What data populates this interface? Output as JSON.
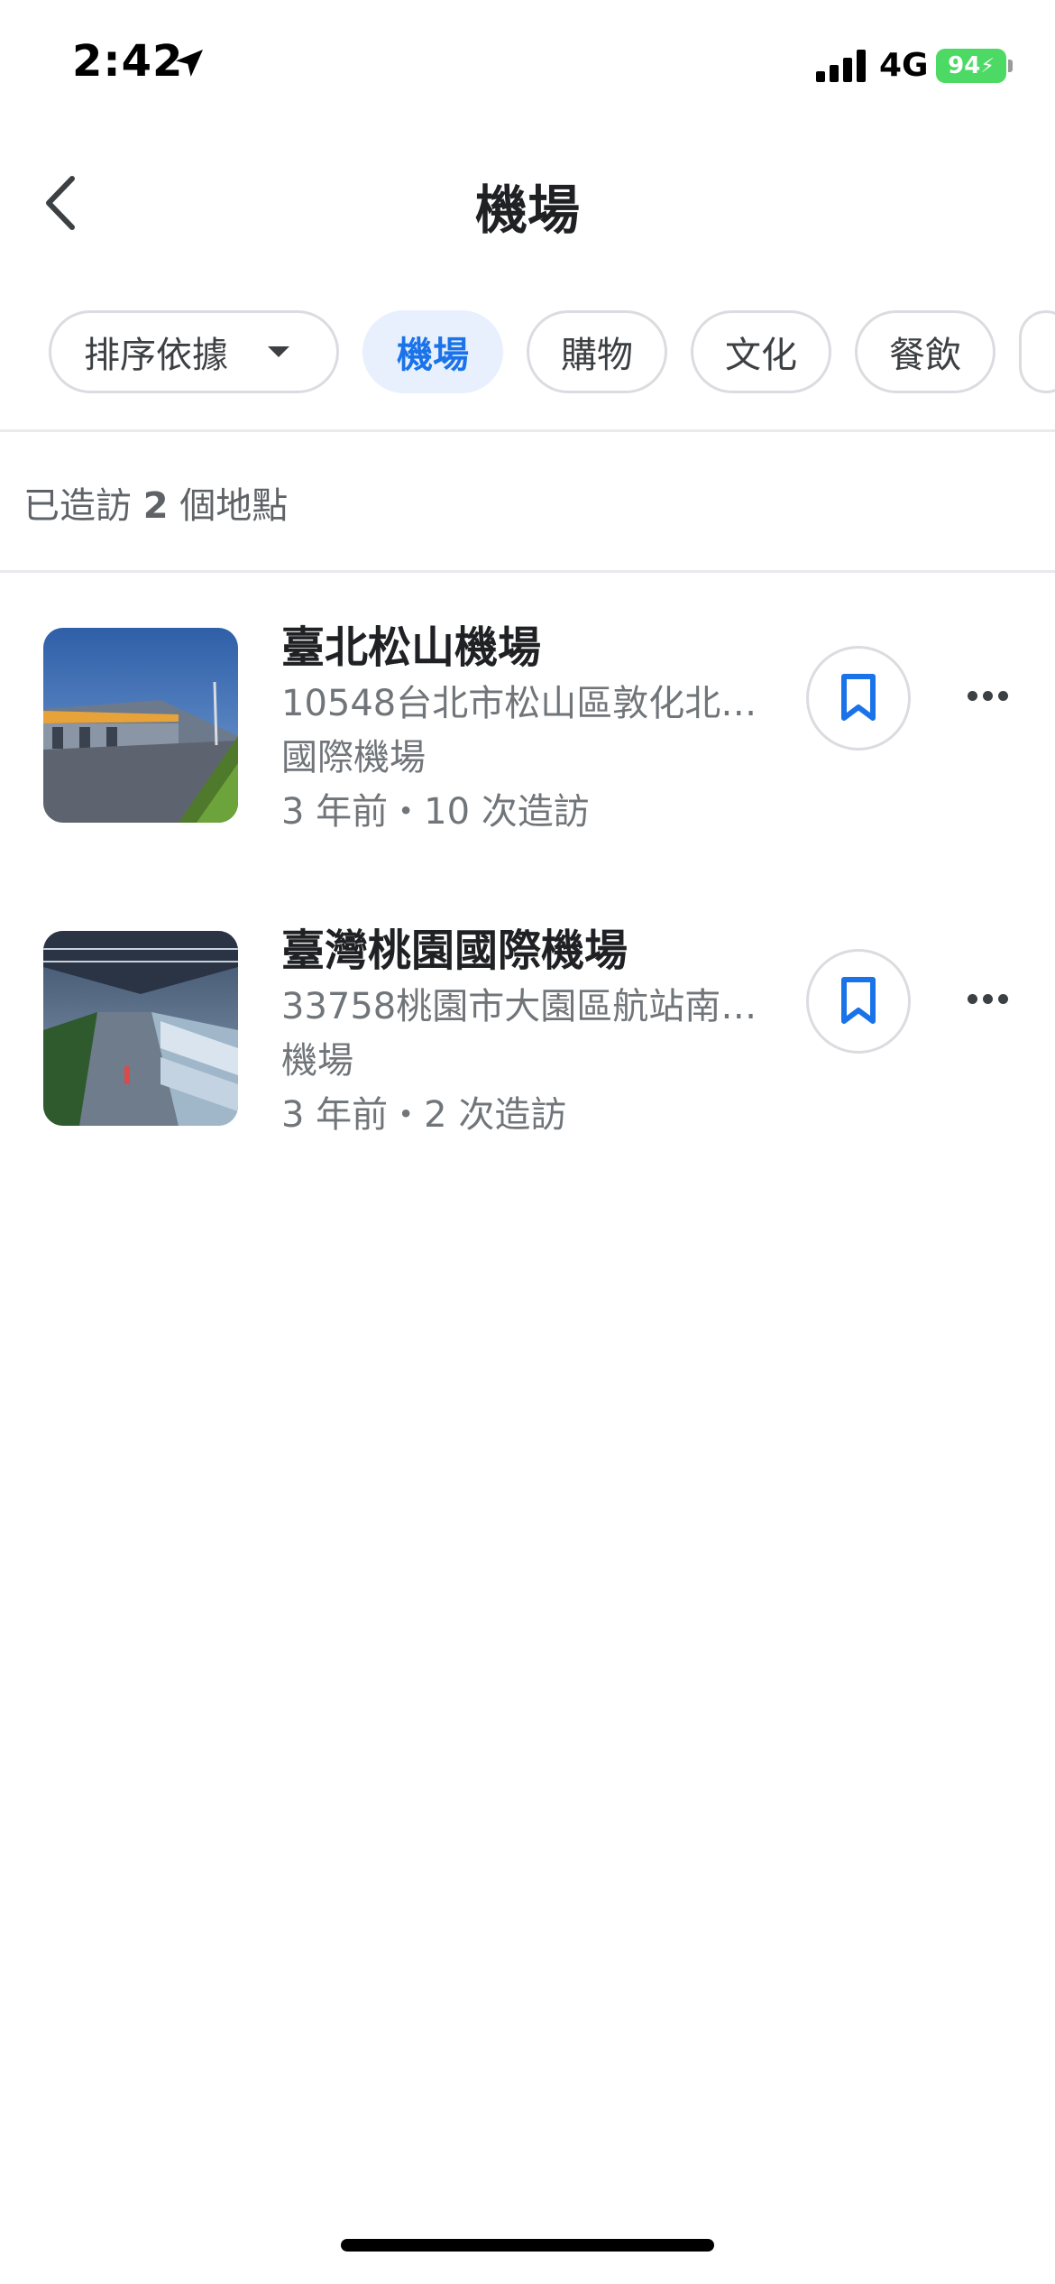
{
  "status_bar": {
    "time": "2:42",
    "network": "4G",
    "battery": "94",
    "icons": [
      "location-arrow-icon",
      "cellular-signal-icon",
      "battery-charging-icon"
    ]
  },
  "header": {
    "title": "機場",
    "back_icon": "chevron-left-icon"
  },
  "chips": {
    "sort_label": "排序依據",
    "items": [
      "機場",
      "購物",
      "文化",
      "餐飲"
    ],
    "selected": "機場"
  },
  "summary": {
    "prefix": "已造訪",
    "count": "2",
    "suffix": "個地點"
  },
  "places": [
    {
      "name": "臺北松山機場",
      "address": "10548台北市松山區敦化北路...",
      "category": "國際機場",
      "visits": "3 年前・10 次造訪"
    },
    {
      "name": "臺灣桃園國際機場",
      "address": "33758桃園市大園區航站南路...",
      "category": "機場",
      "visits": "3 年前・2 次造訪"
    }
  ],
  "colors": {
    "accent": "#1a73e8",
    "chip_selected_bg": "#e8f0fe",
    "battery": "#4cd964"
  }
}
